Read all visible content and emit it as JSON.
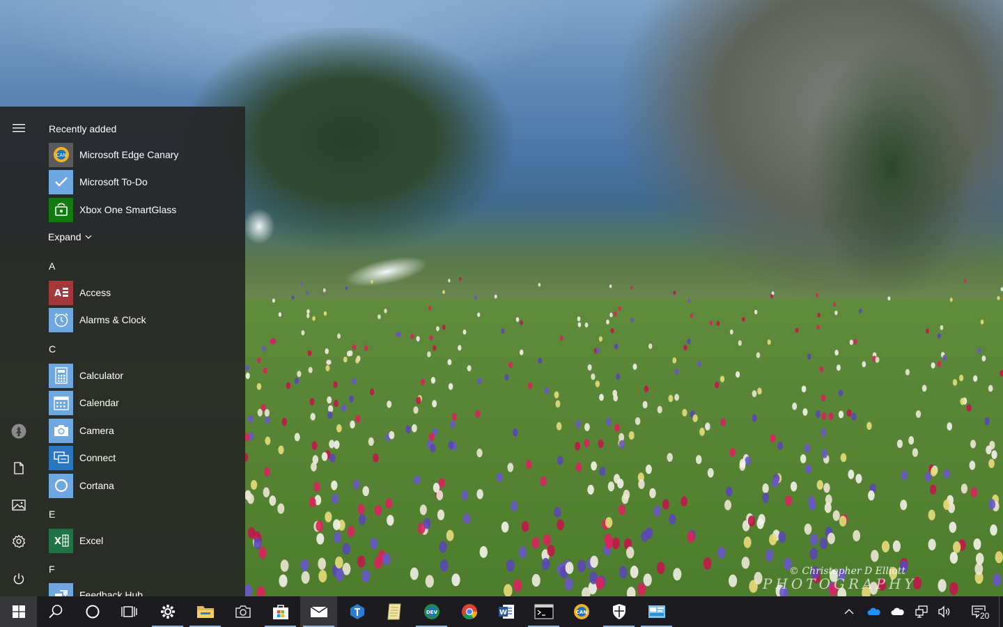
{
  "start_menu": {
    "recently_added": "Recently added",
    "recent_apps": [
      {
        "label": "Microsoft Edge Canary",
        "icon": "edge-canary-icon",
        "color": "#5a5a5a"
      },
      {
        "label": "Microsoft To-Do",
        "icon": "check-icon",
        "color": "#6fa7e0"
      },
      {
        "label": "Xbox One SmartGlass",
        "icon": "xbox-smartglass-icon",
        "color": "#107c10"
      }
    ],
    "expand": "Expand",
    "groups": [
      {
        "letter": "A",
        "apps": [
          {
            "label": "Access",
            "icon": "access-icon",
            "color": "#a4373a"
          },
          {
            "label": "Alarms & Clock",
            "icon": "alarm-clock-icon",
            "color": "#6fa7e0"
          }
        ]
      },
      {
        "letter": "C",
        "apps": [
          {
            "label": "Calculator",
            "icon": "calculator-icon",
            "color": "#6fa7e0"
          },
          {
            "label": "Calendar",
            "icon": "calendar-icon",
            "color": "#6fa7e0"
          },
          {
            "label": "Camera",
            "icon": "camera-icon",
            "color": "#6fa7e0"
          },
          {
            "label": "Connect",
            "icon": "connect-icon",
            "color": "#2a76c0"
          },
          {
            "label": "Cortana",
            "icon": "cortana-icon",
            "color": "#6fa7e0"
          }
        ]
      },
      {
        "letter": "E",
        "apps": [
          {
            "label": "Excel",
            "icon": "excel-icon",
            "color": "#217346"
          }
        ]
      },
      {
        "letter": "F",
        "apps": [
          {
            "label": "Feedback Hub",
            "icon": "feedback-hub-icon",
            "color": "#6fa7e0"
          }
        ]
      }
    ],
    "rail": [
      "hamburger-menu-icon",
      "user-avatar-icon",
      "documents-icon",
      "pictures-icon",
      "settings-gear-icon",
      "power-icon"
    ]
  },
  "taskbar": {
    "accent": "#8ab4e8",
    "items": [
      "start-windows-icon",
      "search-icon",
      "cortana-circle-icon",
      "task-view-icon",
      "settings-gear-icon",
      "file-explorer-icon",
      "camera-icon",
      "microsoft-store-icon",
      "mail-icon",
      "teams-icon",
      "notepad-icon",
      "edge-dev-icon",
      "chrome-icon",
      "word-icon",
      "terminal-icon",
      "edge-canary-icon",
      "windows-security-icon",
      "control-panel-icon"
    ],
    "tray": [
      "show-hidden-chevron-icon",
      "onedrive-blue-icon",
      "onedrive-white-icon",
      "network-icon",
      "volume-icon"
    ],
    "notification_count": "20"
  },
  "wallpaper": {
    "credit_line1": "© Christopher D Elliott",
    "credit_line2": "PHOTOGRAPHY"
  }
}
